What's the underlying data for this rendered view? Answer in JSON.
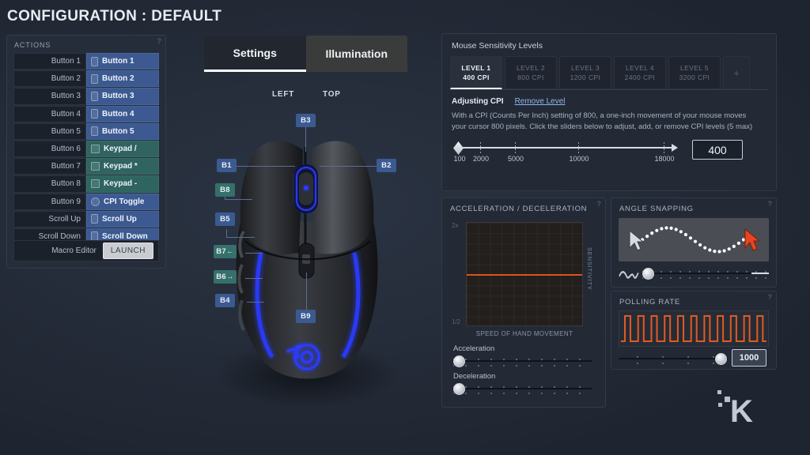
{
  "header": {
    "title": "CONFIGURATION : DEFAULT"
  },
  "actions_panel": {
    "heading": "ACTIONS",
    "help_icon": "?",
    "rows": [
      {
        "label": "Button 1",
        "value": "Button 1",
        "color": "blue",
        "chip": "chip"
      },
      {
        "label": "Button 2",
        "value": "Button 2",
        "color": "blue",
        "chip": "chip"
      },
      {
        "label": "Button 3",
        "value": "Button 3",
        "color": "blue",
        "chip": "chip"
      },
      {
        "label": "Button 4",
        "value": "Button 4",
        "color": "blue",
        "chip": "chip"
      },
      {
        "label": "Button 5",
        "value": "Button 5",
        "color": "blue",
        "chip": "chip"
      },
      {
        "label": "Button 6",
        "value": "Keypad /",
        "color": "teal",
        "chip": "sq"
      },
      {
        "label": "Button 7",
        "value": "Keypad *",
        "color": "teal",
        "chip": "sq"
      },
      {
        "label": "Button 8",
        "value": "Keypad -",
        "color": "teal",
        "chip": "sq"
      },
      {
        "label": "Button 9",
        "value": "CPI Toggle",
        "color": "blue",
        "chip": "rnd"
      },
      {
        "label": "Scroll Up",
        "value": "Scroll Up",
        "color": "blue",
        "chip": "chip"
      },
      {
        "label": "Scroll Down",
        "value": "Scroll Down",
        "color": "blue",
        "chip": "chip"
      }
    ],
    "macro_label": "Macro Editor",
    "macro_button": "LAUNCH"
  },
  "tabs": {
    "settings": "Settings",
    "illumination": "Illumination",
    "active": "Settings"
  },
  "mouse_view": {
    "left_label": "LEFT",
    "top_label": "TOP",
    "callouts": [
      {
        "id": "B3",
        "text": "B3",
        "color": "blue"
      },
      {
        "id": "B1",
        "text": "B1",
        "color": "blue"
      },
      {
        "id": "B2",
        "text": "B2",
        "color": "blue"
      },
      {
        "id": "B8",
        "text": "B8",
        "color": "teal"
      },
      {
        "id": "B5",
        "text": "B5",
        "color": "blue"
      },
      {
        "id": "B7",
        "text": "B7←",
        "color": "teal"
      },
      {
        "id": "B6",
        "text": "B6→",
        "color": "teal"
      },
      {
        "id": "B4",
        "text": "B4",
        "color": "blue"
      },
      {
        "id": "B9",
        "text": "B9",
        "color": "blue"
      }
    ]
  },
  "sensitivity": {
    "title": "Mouse Sensitivity Levels",
    "add_level_icon": "+",
    "levels": [
      {
        "name": "LEVEL 1",
        "cpi": "400 CPI",
        "active": true
      },
      {
        "name": "LEVEL 2",
        "cpi": "800 CPI",
        "active": false
      },
      {
        "name": "LEVEL 3",
        "cpi": "1200 CPI",
        "active": false
      },
      {
        "name": "LEVEL 4",
        "cpi": "2400 CPI",
        "active": false
      },
      {
        "name": "LEVEL 5",
        "cpi": "3200 CPI",
        "active": false
      }
    ],
    "adjusting_label": "Adjusting CPI",
    "remove_link": "Remove Level",
    "description": "With a CPI (Counts Per Inch) setting of 800, a one-inch movement of your mouse moves your cursor 800 pixels. Click the sliders below to adjust, add, or remove CPI levels (5 max)",
    "slider_ticks": [
      "100",
      "2000",
      "5000",
      "10000",
      "18000"
    ],
    "value": "400"
  },
  "acceleration": {
    "heading": "ACCELERATION / DECELERATION",
    "help_icon": "?",
    "axis_max": "2x",
    "axis_min": "1/2",
    "y_axis_label": "SENSITIVITY",
    "x_axis_label": "SPEED OF HAND MOVEMENT",
    "accel_label": "Acceleration",
    "decel_label": "Deceleration",
    "line_color": "#d9551f"
  },
  "angle_snapping": {
    "heading": "ANGLE SNAPPING",
    "help_icon": "?"
  },
  "polling_rate": {
    "heading": "POLLING RATE",
    "help_icon": "?",
    "value": "1000",
    "wave_color": "#e05a24"
  },
  "watermark": {
    "letter": "K"
  }
}
